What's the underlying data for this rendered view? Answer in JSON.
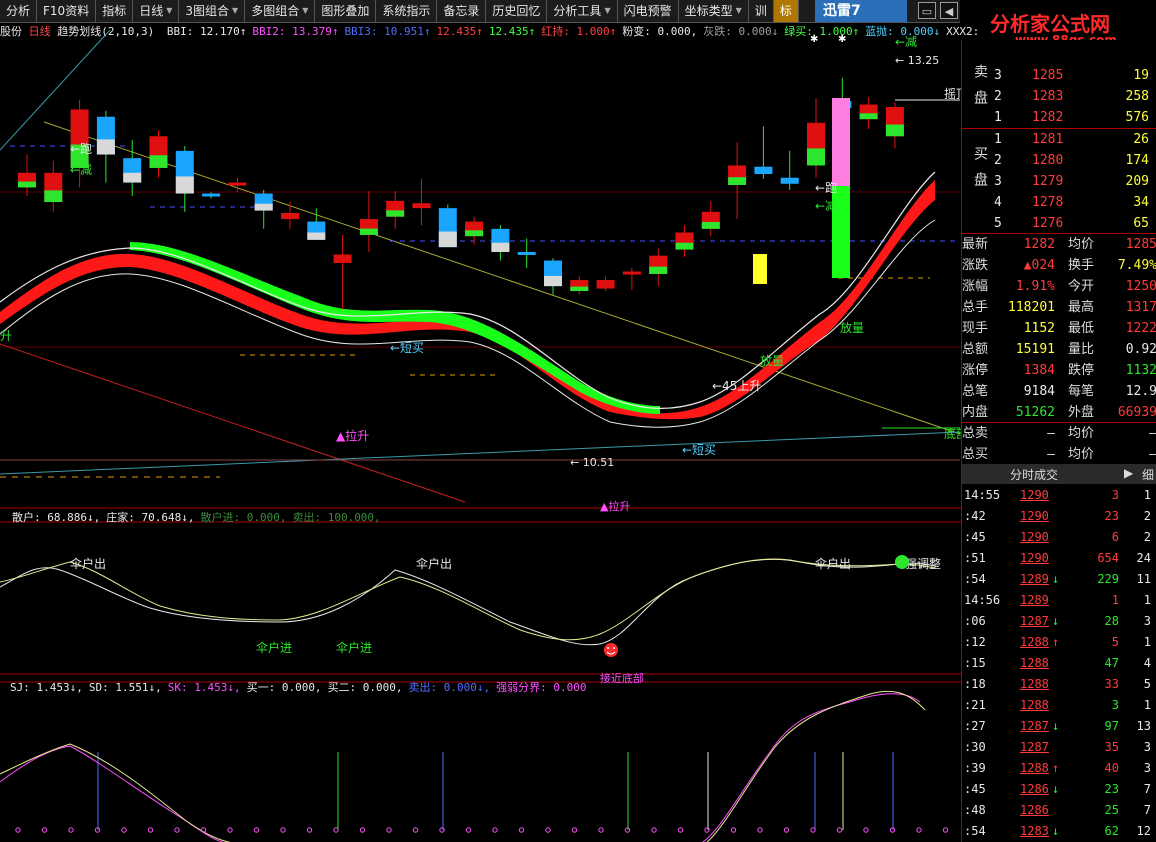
{
  "menu": [
    {
      "label": "分析",
      "arrow": false
    },
    {
      "label": "F10资料",
      "arrow": false
    },
    {
      "label": "指标",
      "arrow": false
    },
    {
      "label": "日线",
      "arrow": true
    },
    {
      "label": "3图组合",
      "arrow": true
    },
    {
      "label": "多图组合",
      "arrow": true
    },
    {
      "label": "图形叠加",
      "arrow": false
    },
    {
      "label": "系统指示",
      "arrow": false
    },
    {
      "label": "备忘录",
      "arrow": false
    },
    {
      "label": "历史回忆",
      "arrow": false
    },
    {
      "label": "分析工具",
      "arrow": true
    },
    {
      "label": "闪电预警",
      "arrow": false
    },
    {
      "label": "坐标类型",
      "arrow": true
    },
    {
      "label": "训",
      "arrow": false
    },
    {
      "label": "标",
      "arrow": false
    }
  ],
  "xunlei": "迅雷7",
  "logo": {
    "text": "分析家公式网",
    "url": "www.88gs.com"
  },
  "main_indicator": {
    "prefix": "股份",
    "period": "日线",
    "name": "趋势划线(2,10,3)",
    "items": [
      {
        "label": "BBI: 12.170↑",
        "color": "#e8e8e8"
      },
      {
        "label": "BBI2: 13.379↑",
        "color": "#ff4fff"
      },
      {
        "label": "BBI3: 10.951↑",
        "color": "#4f6fff"
      },
      {
        "label": "12.435↑",
        "color": "#ff4444"
      },
      {
        "label": "12.435↑",
        "color": "#44ff44"
      },
      {
        "label": "红持: 1.000↑",
        "color": "#ff4444"
      },
      {
        "label": "粉变: 0.000,",
        "color": "#e8e8e8"
      },
      {
        "label": "灰跌: 0.000↓",
        "color": "#a0a0a0"
      },
      {
        "label": "绿买: 1.000↑",
        "color": "#44ff44"
      },
      {
        "label": "蓝抛: 0.000↓",
        "color": "#4fd0ff"
      },
      {
        "label": "XXX2:",
        "color": "#e8e8e8"
      }
    ]
  },
  "annotations": {
    "pao": "←跑",
    "jian": "←减",
    "lasheng": "▲拉升",
    "duanmai": "←短买",
    "duanmai2": "←短买",
    "low_price": "← 10.51",
    "high_price": "← 13.25",
    "up45": "←45上升",
    "fangliang": "放量",
    "fangliang2": "放量",
    "paoR": "←跑",
    "jianR": "←减",
    "jianTop": "←减",
    "dingbu": "摇顶",
    "dibu": "底部",
    "sheng": "升",
    "lasheng2": "▲拉升"
  },
  "ind2": {
    "items": [
      {
        "label": "散户: 68.886↓,",
        "color": "#e8e8e8"
      },
      {
        "label": "庄家: 70.648↓,",
        "color": "#e8e8e8"
      },
      {
        "label": "散户进: 0.000,",
        "color": "#3a8a3a"
      },
      {
        "label": "卖出: 100.000,",
        "color": "#3a8a3a"
      }
    ],
    "labels": {
      "out1": "伞户出",
      "out2": "伞户出",
      "out3": "伞户出",
      "in1": "伞户进",
      "in2": "伞户进",
      "adjust": "强调整",
      "bottom": "接近底部"
    }
  },
  "ind3": {
    "items": [
      {
        "label": "SJ: 1.453↓,",
        "color": "#e8e8e8"
      },
      {
        "label": "SD: 1.551↓,",
        "color": "#e8e8e8"
      },
      {
        "label": "SK: 1.453↓,",
        "color": "#ff4fff"
      },
      {
        "label": "买一: 0.000,",
        "color": "#e8e8e8"
      },
      {
        "label": "买二: 0.000,",
        "color": "#e8e8e8"
      },
      {
        "label": "卖出: 0.000↓,",
        "color": "#4f6fff"
      },
      {
        "label": "强弱分界: 0.000",
        "color": "#ff4fff"
      }
    ]
  },
  "orderbook": {
    "sell_label": "卖盘",
    "buy_label": "买盘",
    "sell": [
      {
        "n": "3",
        "price": "1285",
        "vol": "19"
      },
      {
        "n": "2",
        "price": "1283",
        "vol": "258"
      },
      {
        "n": "1",
        "price": "1282",
        "vol": "576"
      }
    ],
    "buy": [
      {
        "n": "1",
        "price": "1281",
        "vol": "26"
      },
      {
        "n": "2",
        "price": "1280",
        "vol": "174"
      },
      {
        "n": "3",
        "price": "1279",
        "vol": "209"
      },
      {
        "n": "4",
        "price": "1278",
        "vol": "34"
      },
      {
        "n": "5",
        "price": "1276",
        "vol": "65"
      }
    ]
  },
  "quote": [
    {
      "l1": "最新",
      "v1": "1282",
      "c1": "red",
      "l2": "均价",
      "v2": "1285",
      "c2": "red"
    },
    {
      "l1": "涨跌",
      "v1": "▲024",
      "c1": "red",
      "l2": "换手",
      "v2": "7.49%",
      "c2": "yellow"
    },
    {
      "l1": "涨幅",
      "v1": "1.91%",
      "c1": "red",
      "l2": "今开",
      "v2": "1250",
      "c2": "red"
    },
    {
      "l1": "总手",
      "v1": "118201",
      "c1": "yellow",
      "l2": "最高",
      "v2": "1317",
      "c2": "red"
    },
    {
      "l1": "现手",
      "v1": "1152",
      "c1": "yellow",
      "l2": "最低",
      "v2": "1222",
      "c2": "red"
    },
    {
      "l1": "总额",
      "v1": "15191",
      "c1": "yellow",
      "l2": "量比",
      "v2": "0.92",
      "c2": "white"
    },
    {
      "l1": "涨停",
      "v1": "1384",
      "c1": "red",
      "l2": "跌停",
      "v2": "1132",
      "c2": "green"
    },
    {
      "l1": "总笔",
      "v1": "9184",
      "c1": "white",
      "l2": "每笔",
      "v2": "12.9",
      "c2": "white"
    },
    {
      "l1": "内盘",
      "v1": "51262",
      "c1": "green",
      "l2": "外盘",
      "v2": "66939",
      "c2": "red"
    }
  ],
  "totals": [
    {
      "label": "总卖",
      "value": "–",
      "avg": "均价",
      "avgv": "–"
    },
    {
      "label": "总买",
      "value": "–",
      "avg": "均价",
      "avgv": "–"
    }
  ],
  "ticks_header": {
    "title": "分时成交",
    "btn": "细"
  },
  "ticks": [
    {
      "t": "14:55",
      "p": "1290",
      "pc": "red",
      "a": "",
      "v": "3",
      "vc": "red",
      "n": "1"
    },
    {
      "t": ":42",
      "p": "1290",
      "pc": "red",
      "a": "",
      "v": "23",
      "vc": "red",
      "n": "2"
    },
    {
      "t": ":45",
      "p": "1290",
      "pc": "red",
      "a": "",
      "v": "6",
      "vc": "red",
      "n": "2"
    },
    {
      "t": ":51",
      "p": "1290",
      "pc": "red",
      "a": "",
      "v": "654",
      "vc": "red",
      "n": "24"
    },
    {
      "t": ":54",
      "p": "1289",
      "pc": "red",
      "a": "↓",
      "v": "229",
      "vc": "green",
      "n": "11"
    },
    {
      "t": "14:56",
      "p": "1289",
      "pc": "red",
      "a": "",
      "v": "1",
      "vc": "red",
      "n": "1"
    },
    {
      "t": ":06",
      "p": "1287",
      "pc": "red",
      "a": "↓",
      "v": "28",
      "vc": "green",
      "n": "3"
    },
    {
      "t": ":12",
      "p": "1288",
      "pc": "red",
      "a": "↑",
      "v": "5",
      "vc": "red",
      "n": "1"
    },
    {
      "t": ":15",
      "p": "1288",
      "pc": "red",
      "a": "",
      "v": "47",
      "vc": "green",
      "n": "4"
    },
    {
      "t": ":18",
      "p": "1288",
      "pc": "red",
      "a": "",
      "v": "33",
      "vc": "red",
      "n": "5"
    },
    {
      "t": ":21",
      "p": "1288",
      "pc": "red",
      "a": "",
      "v": "3",
      "vc": "green",
      "n": "1"
    },
    {
      "t": ":27",
      "p": "1287",
      "pc": "red",
      "a": "↓",
      "v": "97",
      "vc": "green",
      "n": "13"
    },
    {
      "t": ":30",
      "p": "1287",
      "pc": "red",
      "a": "",
      "v": "35",
      "vc": "red",
      "n": "3"
    },
    {
      "t": ":39",
      "p": "1288",
      "pc": "red",
      "a": "↑",
      "v": "40",
      "vc": "red",
      "n": "3"
    },
    {
      "t": ":45",
      "p": "1286",
      "pc": "red",
      "a": "↓",
      "v": "23",
      "vc": "green",
      "n": "7"
    },
    {
      "t": ":48",
      "p": "1286",
      "pc": "red",
      "a": "",
      "v": "25",
      "vc": "green",
      "n": "7"
    },
    {
      "t": ":54",
      "p": "1283",
      "pc": "red",
      "a": "↓",
      "v": "62",
      "vc": "green",
      "n": "12"
    }
  ],
  "chart_data": {
    "type": "candlestick",
    "candles": [
      {
        "o": 12.32,
        "c": 12.44,
        "h": 12.59,
        "l": 12.25,
        "s": "up"
      },
      {
        "o": 12.2,
        "c": 12.44,
        "h": 12.54,
        "l": 12.12,
        "s": "up"
      },
      {
        "o": 12.96,
        "c": 12.48,
        "h": 13.04,
        "l": 12.32,
        "s": "up"
      },
      {
        "o": 12.9,
        "c": 12.59,
        "h": 12.95,
        "l": 12.36,
        "s": "bl"
      },
      {
        "o": 12.56,
        "c": 12.36,
        "h": 12.71,
        "l": 12.25,
        "s": "bl"
      },
      {
        "o": 12.74,
        "c": 12.48,
        "h": 12.79,
        "l": 12.4,
        "s": "up"
      },
      {
        "o": 12.62,
        "c": 12.27,
        "h": 12.66,
        "l": 12.12,
        "s": "bl"
      },
      {
        "o": 12.27,
        "c": 12.25,
        "h": 12.28,
        "l": 12.23,
        "s": "bl"
      },
      {
        "o": 12.36,
        "c": 12.34,
        "h": 12.4,
        "l": 12.28,
        "s": "up"
      },
      {
        "o": 12.27,
        "c": 12.13,
        "h": 12.3,
        "l": 11.98,
        "s": "bl"
      },
      {
        "o": 12.11,
        "c": 12.06,
        "h": 12.2,
        "l": 11.98,
        "s": "up"
      },
      {
        "o": 12.04,
        "c": 11.89,
        "h": 12.15,
        "l": 11.89,
        "s": "bl"
      },
      {
        "o": 11.7,
        "c": 11.77,
        "h": 11.93,
        "l": 11.32,
        "s": "up"
      },
      {
        "o": 11.93,
        "c": 12.06,
        "h": 12.29,
        "l": 11.79,
        "s": "up"
      },
      {
        "o": 12.08,
        "c": 12.21,
        "h": 12.29,
        "l": 11.98,
        "s": "up"
      },
      {
        "o": 12.19,
        "c": 12.15,
        "h": 12.39,
        "l": 12.01,
        "s": "up"
      },
      {
        "o": 12.15,
        "c": 11.83,
        "h": 12.18,
        "l": 11.83,
        "s": "bl"
      },
      {
        "o": 12.04,
        "c": 11.92,
        "h": 12.08,
        "l": 11.85,
        "s": "up"
      },
      {
        "o": 11.98,
        "c": 11.79,
        "h": 12.01,
        "l": 11.72,
        "s": "bl"
      },
      {
        "o": 11.79,
        "c": 11.77,
        "h": 11.9,
        "l": 11.66,
        "s": "bl"
      },
      {
        "o": 11.72,
        "c": 11.51,
        "h": 11.74,
        "l": 11.44,
        "s": "bl"
      },
      {
        "o": 11.47,
        "c": 11.56,
        "h": 11.59,
        "l": 11.44,
        "s": "up"
      },
      {
        "o": 11.49,
        "c": 11.56,
        "h": 11.59,
        "l": 11.47,
        "s": "up"
      },
      {
        "o": 11.61,
        "c": 11.63,
        "h": 11.66,
        "l": 11.48,
        "s": "up"
      },
      {
        "o": 11.61,
        "c": 11.76,
        "h": 11.82,
        "l": 11.51,
        "s": "up"
      },
      {
        "o": 11.81,
        "c": 11.95,
        "h": 12.01,
        "l": 11.75,
        "s": "up"
      },
      {
        "o": 11.98,
        "c": 12.12,
        "h": 12.21,
        "l": 11.92,
        "s": "up"
      },
      {
        "o": 12.5,
        "c": 12.34,
        "h": 12.69,
        "l": 12.06,
        "s": "up"
      },
      {
        "o": 12.49,
        "c": 12.43,
        "h": 12.82,
        "l": 12.39,
        "s": "bl"
      },
      {
        "o": 12.4,
        "c": 12.35,
        "h": 12.62,
        "l": 12.3,
        "s": "bl"
      },
      {
        "o": 12.5,
        "c": 12.85,
        "h": 13.05,
        "l": 12.4,
        "s": "up"
      },
      {
        "o": 12.97,
        "c": 13.03,
        "h": 13.22,
        "l": 12.79,
        "s": "bl"
      },
      {
        "o": 13.0,
        "c": 12.88,
        "h": 13.06,
        "l": 12.8,
        "s": "up"
      },
      {
        "o": 12.74,
        "c": 12.98,
        "h": 13.02,
        "l": 12.64,
        "s": "up"
      }
    ],
    "prices_shown": {
      "high": 13.25,
      "low": 10.51
    }
  }
}
